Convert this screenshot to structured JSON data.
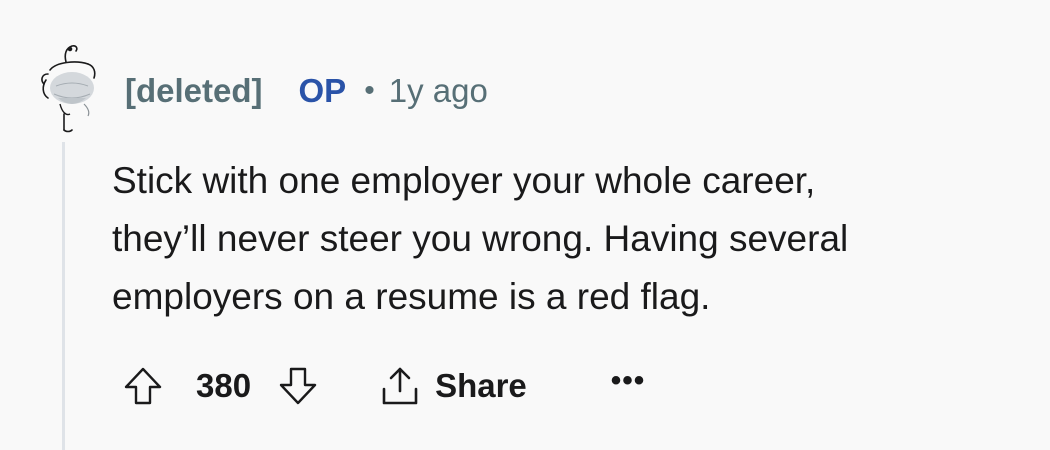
{
  "comment": {
    "author": "[deleted]",
    "op_badge": "OP",
    "separator": "•",
    "timestamp": "1y ago",
    "body_lines": [
      "Stick with one employer your whole career,",
      "they’ll never steer you wrong. Having several",
      "employers on a resume is a red flag."
    ],
    "score": "380",
    "share_label": "Share",
    "more_label": "•••"
  },
  "icons": {
    "avatar": "deleted-user-snoo-icon",
    "upvote": "arrow-up-icon",
    "downvote": "arrow-down-icon",
    "share": "share-icon",
    "more": "more-options-icon"
  },
  "colors": {
    "background": "#f9f9f9",
    "text": "#1a1a1b",
    "meta": "#576f76",
    "op": "#2a53a8",
    "thread_line": "#dfe3e8"
  }
}
